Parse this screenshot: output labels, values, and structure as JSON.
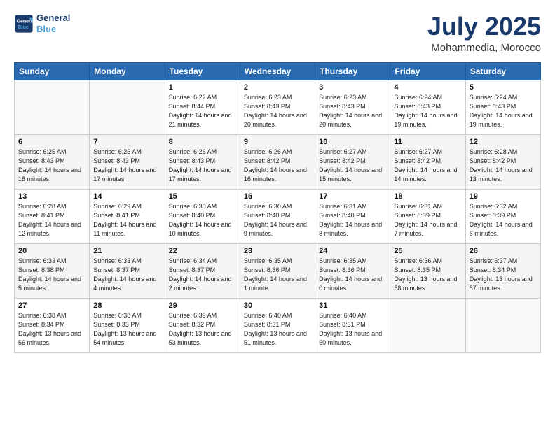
{
  "header": {
    "logo_line1": "General",
    "logo_line2": "Blue",
    "month": "July 2025",
    "location": "Mohammedia, Morocco"
  },
  "weekdays": [
    "Sunday",
    "Monday",
    "Tuesday",
    "Wednesday",
    "Thursday",
    "Friday",
    "Saturday"
  ],
  "weeks": [
    [
      {
        "day": "",
        "info": ""
      },
      {
        "day": "",
        "info": ""
      },
      {
        "day": "1",
        "info": "Sunrise: 6:22 AM\nSunset: 8:44 PM\nDaylight: 14 hours and 21 minutes."
      },
      {
        "day": "2",
        "info": "Sunrise: 6:23 AM\nSunset: 8:43 PM\nDaylight: 14 hours and 20 minutes."
      },
      {
        "day": "3",
        "info": "Sunrise: 6:23 AM\nSunset: 8:43 PM\nDaylight: 14 hours and 20 minutes."
      },
      {
        "day": "4",
        "info": "Sunrise: 6:24 AM\nSunset: 8:43 PM\nDaylight: 14 hours and 19 minutes."
      },
      {
        "day": "5",
        "info": "Sunrise: 6:24 AM\nSunset: 8:43 PM\nDaylight: 14 hours and 19 minutes."
      }
    ],
    [
      {
        "day": "6",
        "info": "Sunrise: 6:25 AM\nSunset: 8:43 PM\nDaylight: 14 hours and 18 minutes."
      },
      {
        "day": "7",
        "info": "Sunrise: 6:25 AM\nSunset: 8:43 PM\nDaylight: 14 hours and 17 minutes."
      },
      {
        "day": "8",
        "info": "Sunrise: 6:26 AM\nSunset: 8:43 PM\nDaylight: 14 hours and 17 minutes."
      },
      {
        "day": "9",
        "info": "Sunrise: 6:26 AM\nSunset: 8:42 PM\nDaylight: 14 hours and 16 minutes."
      },
      {
        "day": "10",
        "info": "Sunrise: 6:27 AM\nSunset: 8:42 PM\nDaylight: 14 hours and 15 minutes."
      },
      {
        "day": "11",
        "info": "Sunrise: 6:27 AM\nSunset: 8:42 PM\nDaylight: 14 hours and 14 minutes."
      },
      {
        "day": "12",
        "info": "Sunrise: 6:28 AM\nSunset: 8:42 PM\nDaylight: 14 hours and 13 minutes."
      }
    ],
    [
      {
        "day": "13",
        "info": "Sunrise: 6:28 AM\nSunset: 8:41 PM\nDaylight: 14 hours and 12 minutes."
      },
      {
        "day": "14",
        "info": "Sunrise: 6:29 AM\nSunset: 8:41 PM\nDaylight: 14 hours and 11 minutes."
      },
      {
        "day": "15",
        "info": "Sunrise: 6:30 AM\nSunset: 8:40 PM\nDaylight: 14 hours and 10 minutes."
      },
      {
        "day": "16",
        "info": "Sunrise: 6:30 AM\nSunset: 8:40 PM\nDaylight: 14 hours and 9 minutes."
      },
      {
        "day": "17",
        "info": "Sunrise: 6:31 AM\nSunset: 8:40 PM\nDaylight: 14 hours and 8 minutes."
      },
      {
        "day": "18",
        "info": "Sunrise: 6:31 AM\nSunset: 8:39 PM\nDaylight: 14 hours and 7 minutes."
      },
      {
        "day": "19",
        "info": "Sunrise: 6:32 AM\nSunset: 8:39 PM\nDaylight: 14 hours and 6 minutes."
      }
    ],
    [
      {
        "day": "20",
        "info": "Sunrise: 6:33 AM\nSunset: 8:38 PM\nDaylight: 14 hours and 5 minutes."
      },
      {
        "day": "21",
        "info": "Sunrise: 6:33 AM\nSunset: 8:37 PM\nDaylight: 14 hours and 4 minutes."
      },
      {
        "day": "22",
        "info": "Sunrise: 6:34 AM\nSunset: 8:37 PM\nDaylight: 14 hours and 2 minutes."
      },
      {
        "day": "23",
        "info": "Sunrise: 6:35 AM\nSunset: 8:36 PM\nDaylight: 14 hours and 1 minute."
      },
      {
        "day": "24",
        "info": "Sunrise: 6:35 AM\nSunset: 8:36 PM\nDaylight: 14 hours and 0 minutes."
      },
      {
        "day": "25",
        "info": "Sunrise: 6:36 AM\nSunset: 8:35 PM\nDaylight: 13 hours and 58 minutes."
      },
      {
        "day": "26",
        "info": "Sunrise: 6:37 AM\nSunset: 8:34 PM\nDaylight: 13 hours and 57 minutes."
      }
    ],
    [
      {
        "day": "27",
        "info": "Sunrise: 6:38 AM\nSunset: 8:34 PM\nDaylight: 13 hours and 56 minutes."
      },
      {
        "day": "28",
        "info": "Sunrise: 6:38 AM\nSunset: 8:33 PM\nDaylight: 13 hours and 54 minutes."
      },
      {
        "day": "29",
        "info": "Sunrise: 6:39 AM\nSunset: 8:32 PM\nDaylight: 13 hours and 53 minutes."
      },
      {
        "day": "30",
        "info": "Sunrise: 6:40 AM\nSunset: 8:31 PM\nDaylight: 13 hours and 51 minutes."
      },
      {
        "day": "31",
        "info": "Sunrise: 6:40 AM\nSunset: 8:31 PM\nDaylight: 13 hours and 50 minutes."
      },
      {
        "day": "",
        "info": ""
      },
      {
        "day": "",
        "info": ""
      }
    ]
  ]
}
